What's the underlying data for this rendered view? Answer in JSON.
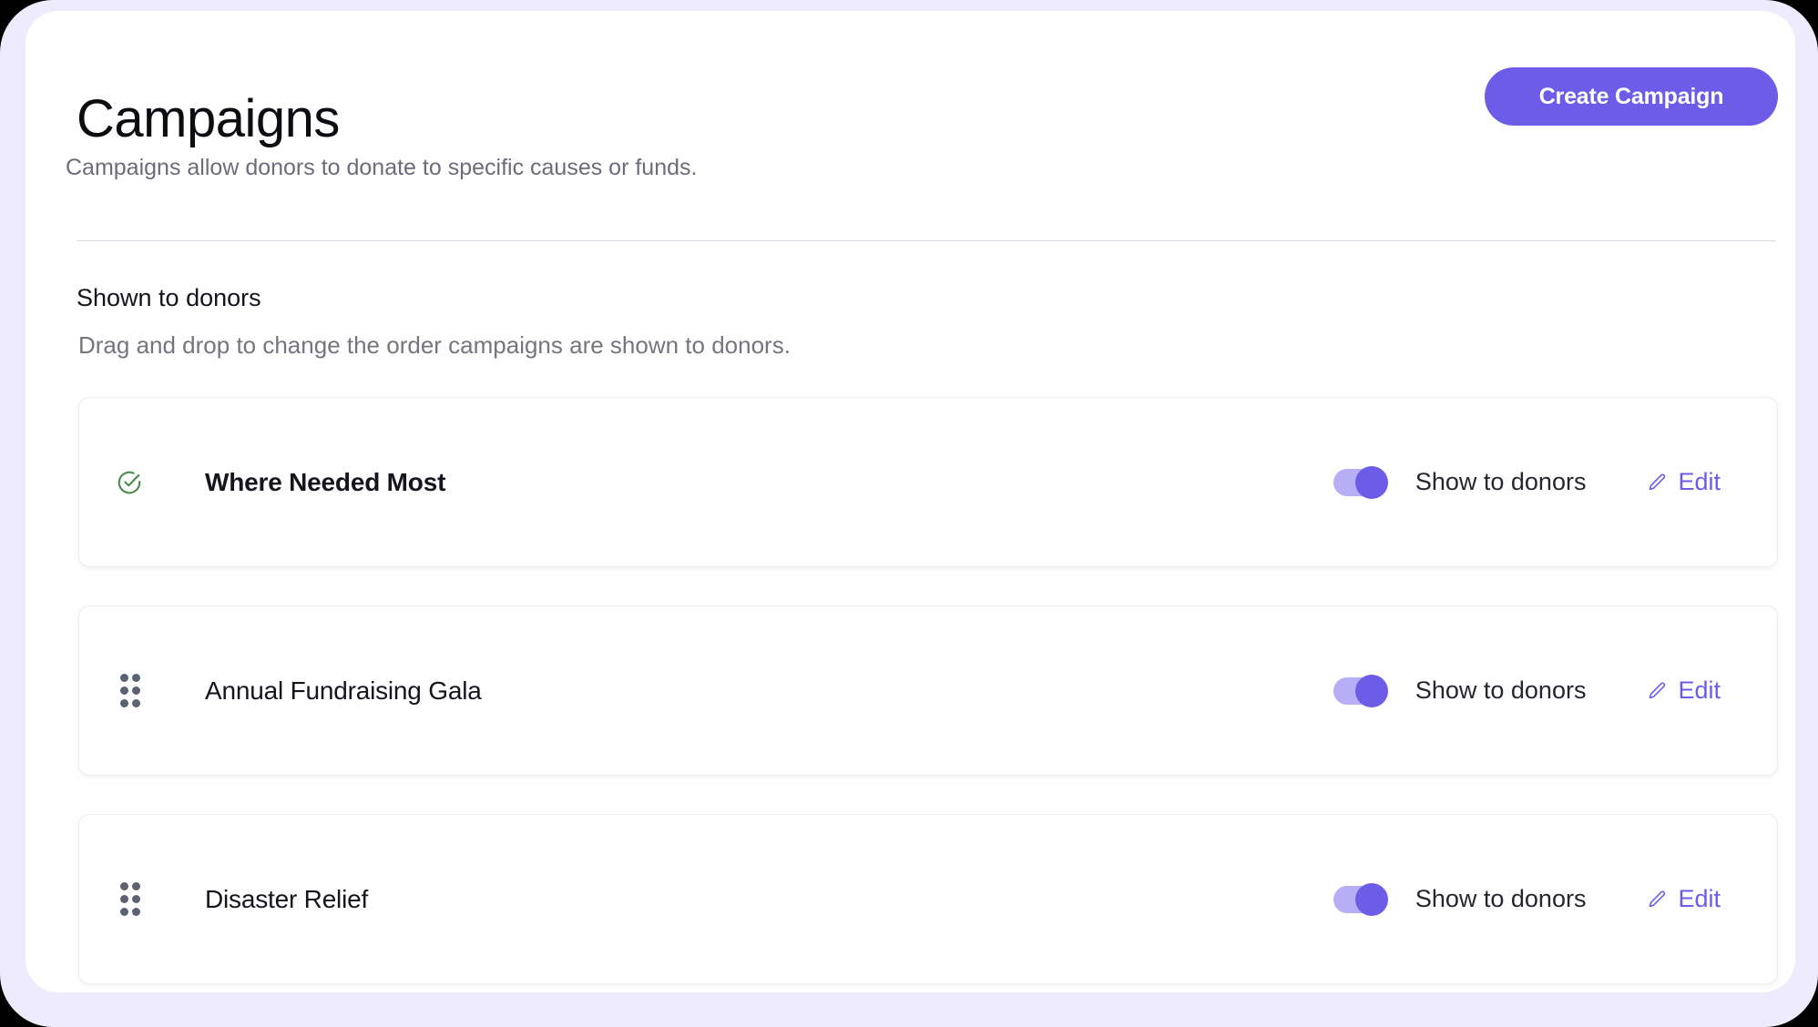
{
  "header": {
    "title": "Campaigns",
    "subtitle": "Campaigns allow donors to donate to specific causes or funds.",
    "create_button_label": "Create Campaign"
  },
  "section": {
    "title": "Shown to donors",
    "subtitle": "Drag and drop to change the order campaigns are shown to donors."
  },
  "campaigns": [
    {
      "name": "Where Needed Most",
      "leading_icon": "circle-check-icon",
      "toggle_label": "Show to donors",
      "toggle_on": true,
      "edit_label": "Edit"
    },
    {
      "name": "Annual Fundraising Gala",
      "leading_icon": "drag-handle-icon",
      "toggle_label": "Show to donors",
      "toggle_on": true,
      "edit_label": "Edit"
    },
    {
      "name": "Disaster Relief",
      "leading_icon": "drag-handle-icon",
      "toggle_label": "Show to donors",
      "toggle_on": true,
      "edit_label": "Edit"
    }
  ],
  "colors": {
    "accent_purple": "#6C5CE7",
    "toggle_track": "#B7AEF6",
    "frame_lavender": "#EEEBFE",
    "check_green": "#4C8B4F",
    "muted_text": "#6C6C7B"
  }
}
